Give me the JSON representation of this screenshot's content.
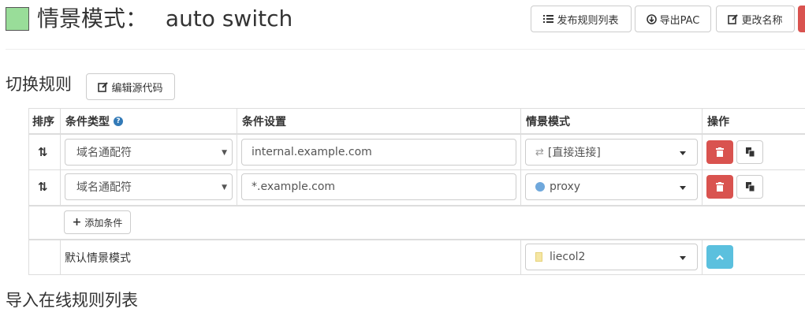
{
  "header": {
    "title_cn": "情景模式：",
    "title_name": "auto switch",
    "color_swatch": "#99dd99",
    "buttons": {
      "publish": "发布规则列表",
      "export": "导出PAC",
      "rename": "更改名称"
    }
  },
  "switch_rules": {
    "heading": "切换规则",
    "edit_source": "编辑源代码",
    "columns": {
      "sort": "排序",
      "condition_type": "条件类型",
      "condition_setting": "条件设置",
      "profile": "情景模式",
      "actions": "操作"
    },
    "rows": [
      {
        "condition_type": "域名通配符",
        "condition_value": "internal.example.com",
        "profile": "[直接连接]",
        "profile_icon": "direct-icon"
      },
      {
        "condition_type": "域名通配符",
        "condition_value": "*.example.com",
        "profile": "proxy",
        "profile_icon": "globe-icon"
      }
    ],
    "add_condition": "添加条件",
    "default_label": "默认情景模式",
    "default_profile": "liecol2",
    "default_profile_icon": "file-icon"
  },
  "online_rules": {
    "heading": "导入在线规则列表"
  },
  "colors": {
    "danger": "#d9534f",
    "info": "#5bc0de",
    "swatch": "#99dd99"
  }
}
